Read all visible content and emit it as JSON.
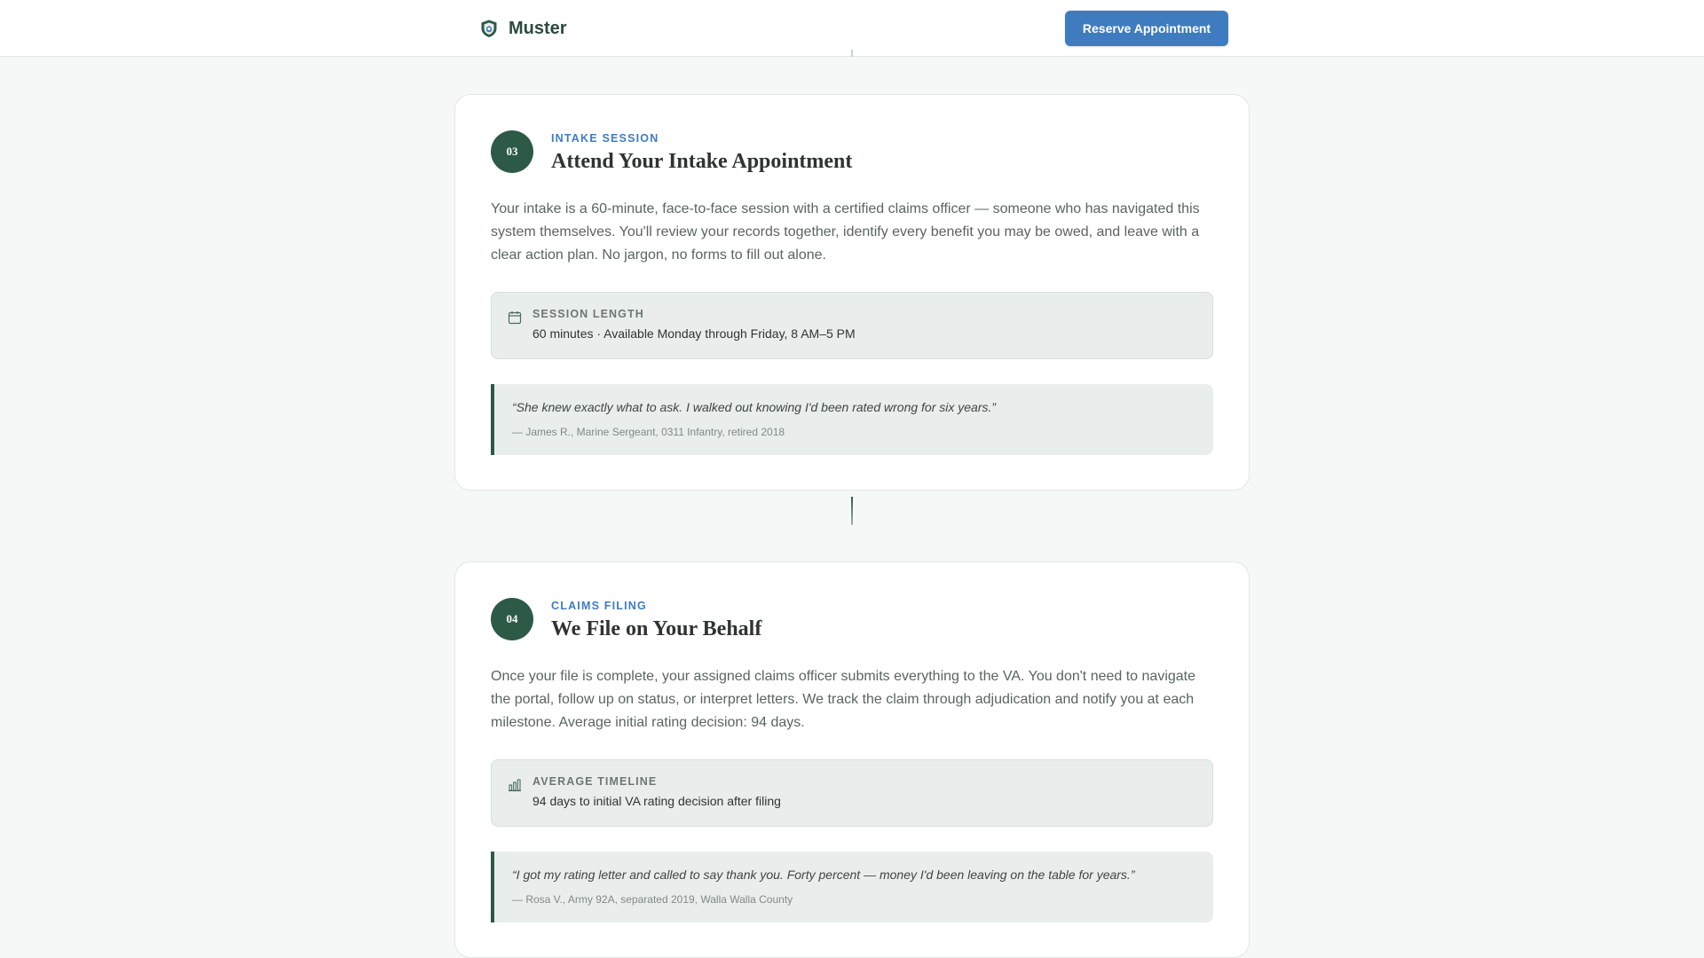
{
  "header": {
    "brand_name": "Muster",
    "brand_icon": "shield-icon",
    "reserve_label": "Reserve Appointment",
    "accent_color": "#3f7cbf",
    "brand_color": "#2c5a46"
  },
  "steps": [
    {
      "number": "03",
      "eyebrow": "INTAKE SESSION",
      "title": "Attend Your Intake Appointment",
      "body": "Your intake is a 60-minute, face-to-face session with a certified claims officer — someone who has navigated this system themselves. You'll review your records together, identify every benefit you may be owed, and leave with a clear action plan. No jargon, no forms to fill out alone.",
      "info": {
        "icon": "calendar-icon",
        "label": "SESSION LENGTH",
        "value": "60 minutes · Available Monday through Friday, 8 AM–5 PM"
      },
      "quote": {
        "text": "“She knew exactly what to ask. I walked out knowing I'd been rated wrong for six years.”",
        "cite": "— James R., Marine Sergeant, 0311 Infantry, retired 2018"
      }
    },
    {
      "number": "04",
      "eyebrow": "CLAIMS FILING",
      "title": "We File on Your Behalf",
      "body": "Once your file is complete, your assigned claims officer submits everything to the VA. You don't need to navigate the portal, follow up on status, or interpret letters. We track the claim through adjudication and notify you at each milestone. Average initial rating decision: 94 days.",
      "info": {
        "icon": "bar-chart-icon",
        "label": "AVERAGE TIMELINE",
        "value": "94 days to initial VA rating decision after filing"
      },
      "quote": {
        "text": "“I got my rating letter and called to say thank you. Forty percent — money I'd been leaving on the table for years.”",
        "cite": "— Rosa V., Army 92A, separated 2019, Walla Walla County"
      }
    }
  ]
}
